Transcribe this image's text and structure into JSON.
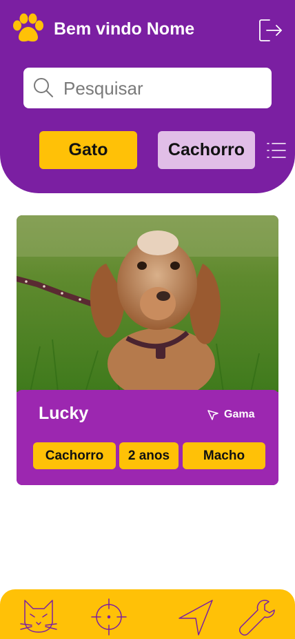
{
  "header": {
    "title": "Bem vindo Nome",
    "brand_color": "#7b1fa2",
    "logo_icon": "paw-icon",
    "logout_icon": "logout-icon"
  },
  "search": {
    "placeholder": "Pesquisar",
    "value": ""
  },
  "filters": {
    "buttons": [
      {
        "label": "Gato",
        "state": "active",
        "color": "#ffc107"
      },
      {
        "label": "Cachorro",
        "state": "inactive",
        "color": "#e1bee7"
      }
    ],
    "menu_icon": "list-menu-icon"
  },
  "pets": [
    {
      "name": "Lucky",
      "location": "Gama",
      "photo_description_icon": "dog-photo",
      "tags": [
        "Cachorro",
        "2 anos",
        "Macho"
      ]
    }
  ],
  "bottom_nav": {
    "color": "#ffc107",
    "items": [
      {
        "icon": "cat-icon"
      },
      {
        "icon": "crosshair-icon"
      },
      {
        "icon": "send-icon"
      },
      {
        "icon": "wrench-icon"
      }
    ]
  }
}
